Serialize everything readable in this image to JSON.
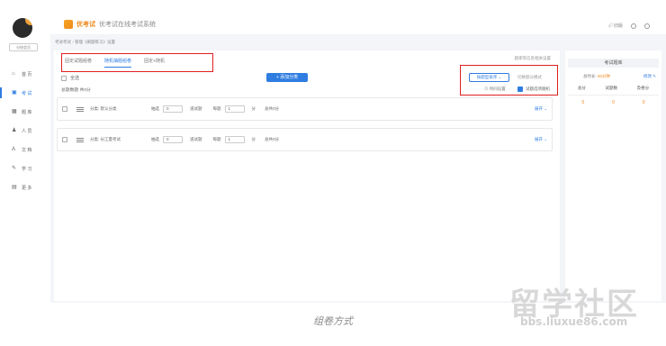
{
  "sidebar": {
    "switch_label": "分校会员",
    "items": [
      {
        "icon": "home-icon",
        "glyph": "⌂",
        "label": "首 页"
      },
      {
        "icon": "exam-icon",
        "glyph": "▣",
        "label": "考 试"
      },
      {
        "icon": "question-bank-icon",
        "glyph": "▦",
        "label": "题 库"
      },
      {
        "icon": "person-icon",
        "glyph": "♟",
        "label": "人 员"
      },
      {
        "icon": "text-icon",
        "glyph": "A",
        "label": "文 档"
      },
      {
        "icon": "learn-icon",
        "glyph": "✎",
        "label": "学 习"
      },
      {
        "icon": "more-icon",
        "glyph": "▤",
        "label": "更 多"
      }
    ]
  },
  "header": {
    "brand_name": "优考试",
    "brand_title": "优考试在线考试系统",
    "exit_label": "⏎ 旧版"
  },
  "breadcrumb": "考试考试 › 管理《刷题练习》设置",
  "tabs": [
    "固定试题组卷",
    "随机抽题组卷",
    "固定+随机"
  ],
  "report_link": "题库等信息相关设置",
  "select_all_label": "全选",
  "add_button": "+ 添加分类",
  "total_label": "总题数题 共0分",
  "mode_button": "按题型排序 ⌄",
  "mode_button2": "切换部分模式",
  "option_time": "⊙ 时间设置",
  "option_random": "试题选项随机",
  "cards": [
    {
      "name": "分类: 默认分类",
      "draw_label": "抽选",
      "draw_value": "0",
      "type_label": "道试题",
      "score_label": "每题",
      "score_value": "1",
      "unit": "分",
      "total": "总共0分",
      "expand": "展开 ⌄"
    },
    {
      "name": "分类: 长江夏考试",
      "draw_label": "抽选",
      "draw_value": "0",
      "type_label": "道试题",
      "score_label": "每题",
      "score_value": "1",
      "unit": "分",
      "total": "总共0分",
      "expand": "展开 ⌄"
    }
  ],
  "right_panel": {
    "title": "考试题库",
    "time_label": "总时长: ",
    "time_value": "60分钟",
    "edit_label": "修改 ✎",
    "headers": [
      "总分",
      "试题数",
      "及格分"
    ],
    "values": [
      "0",
      "0",
      "0"
    ]
  },
  "caption": "组卷方式",
  "watermark": "留学社区",
  "watermark_url": "bbs.liuxue86.com",
  "colors": {
    "accent": "#2f7de1",
    "brand": "#f08a1e",
    "highlight": "#e02020"
  }
}
